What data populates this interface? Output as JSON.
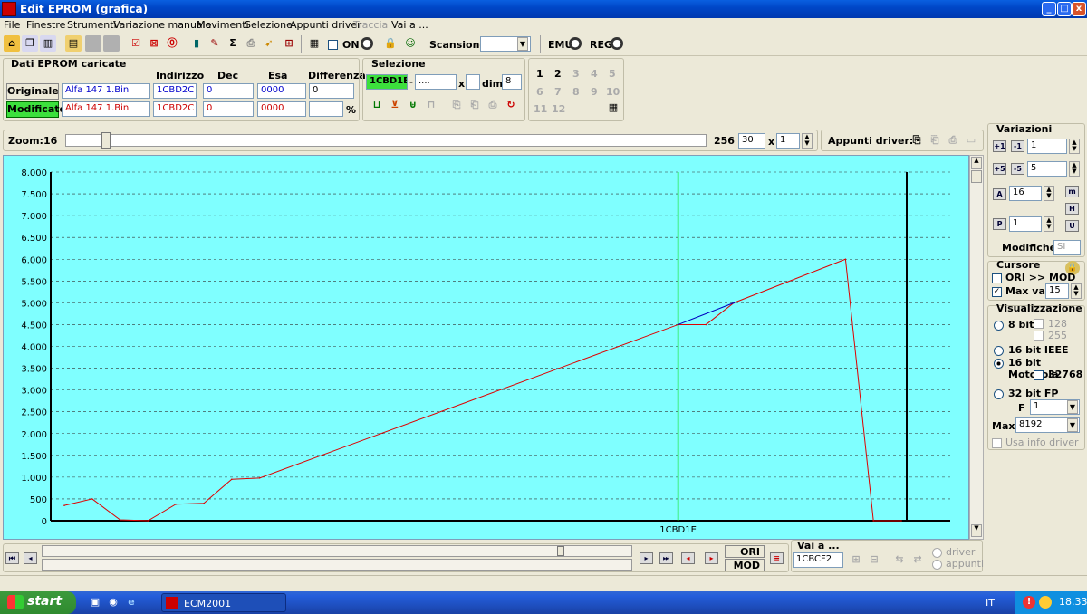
{
  "window": {
    "title": "Edit EPROM (grafica)",
    "minimize": "_",
    "maximize": "□",
    "close": "x"
  },
  "menu": [
    "File",
    "Finestre",
    "Strumenti",
    "Variazione manuale",
    "Movimenti",
    "Selezione",
    "Appunti driver",
    "Traccia",
    "Vai a ..."
  ],
  "toolbar": {
    "on_label": "ON",
    "scansione_label": "Scansione",
    "scansione_value": "",
    "emu_label": "EMU",
    "reg_label": "REG"
  },
  "dati": {
    "title": "Dati EPROM caricate",
    "col_indirizzo": "Indirizzo",
    "col_dec": "Dec",
    "col_esa": "Esa",
    "col_diff": "Differenza",
    "originale": {
      "label": "Originale",
      "file": "Alfa 147 1.Bin",
      "addr": "1CBD2C",
      "dec": "0",
      "esa": "0000",
      "diff": "0"
    },
    "modificato": {
      "label": "Modificato",
      "file": "Alfa 147 1.Bin",
      "addr": "1CBD2C",
      "dec": "0",
      "esa": "0000",
      "diff": "",
      "pct": "%"
    }
  },
  "selezione": {
    "title": "Selezione",
    "addr": "1CBD1E",
    "to": "....",
    "x": "x",
    "dim_label": "dim.",
    "dim": "8"
  },
  "numbers": [
    "1",
    "2",
    "3",
    "4",
    "5",
    "6",
    "7",
    "8",
    "9",
    "10",
    "11",
    "12"
  ],
  "zoom": {
    "label": "Zoom:",
    "min": "16",
    "max": "256",
    "value": "30",
    "x": "x",
    "mult": "1",
    "appunti": "Appunti driver:"
  },
  "chart_data": {
    "type": "line",
    "x_label": "1CBD1E",
    "y_ticks": [
      "8.000",
      "7.500",
      "7.000",
      "6.500",
      "6.000",
      "5.500",
      "5.000",
      "4.500",
      "4.000",
      "3.500",
      "3.000",
      "2.500",
      "2.000",
      "1.500",
      "1.000",
      "500",
      "0"
    ],
    "ylim": [
      0,
      8000
    ],
    "grid": true,
    "cursor_index": 22,
    "series": [
      {
        "color": "#e00000",
        "values": [
          350,
          500,
          20,
          0,
          380,
          400,
          950,
          980,
          4500,
          4500,
          5000,
          6000,
          0,
          0
        ],
        "x": [
          0,
          1,
          2,
          3,
          4,
          5,
          6,
          7,
          22,
          23,
          24,
          28,
          29,
          30
        ]
      },
      {
        "color": "#0000c0",
        "values": [
          4500,
          5000
        ],
        "x": [
          22,
          24
        ]
      }
    ]
  },
  "variazioni": {
    "title": "Variazioni",
    "v1": "1",
    "v2": "5",
    "v3": "16",
    "v4": "1",
    "modifiche_label": "Modifiche:",
    "modifiche": "SI"
  },
  "cursore": {
    "title": "Cursore",
    "ori_mod": "ORI >> MOD",
    "max_var_label": "Max var",
    "max_var": "15"
  },
  "visual": {
    "title": "Visualizzazione",
    "b8": "8 bit",
    "v128": "128",
    "v255": "255",
    "ieee": "16 bit IEEE",
    "motorola": "16 bit Motorola",
    "v32768": "32768",
    "fp32": "32 bit FP",
    "f_label": "F",
    "f_value": "1",
    "max_label": "Max",
    "max_value": "8192",
    "usa_info": "Usa info driver"
  },
  "bottom": {
    "ori": "ORI",
    "mod": "MOD",
    "vai_label": "Vai a ...",
    "vai_value": "1CBCF2",
    "driver": "driver",
    "appunti": "appunti"
  },
  "taskbar": {
    "start": "start",
    "task": "ECM2001",
    "lang": "IT",
    "time": "18.33"
  }
}
